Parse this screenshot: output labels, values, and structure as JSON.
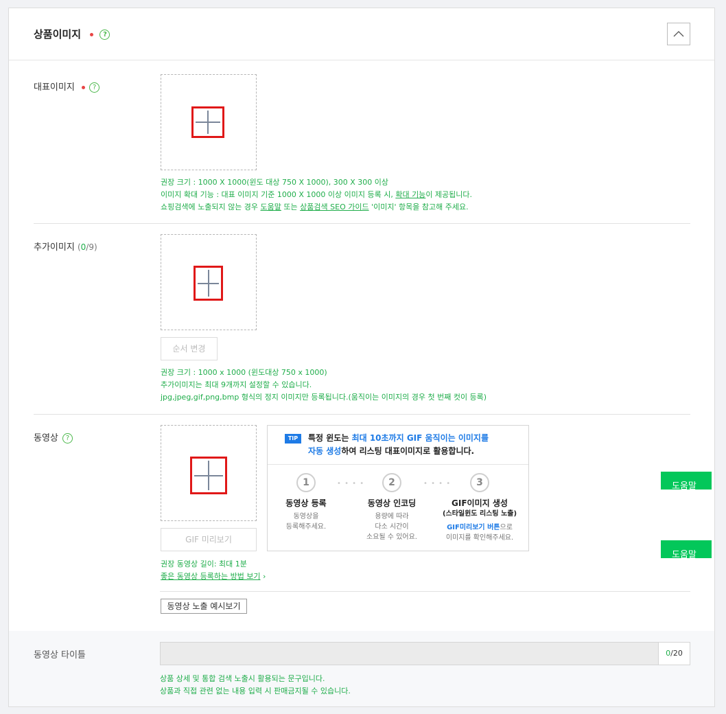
{
  "section": {
    "title": "상품이미지",
    "help": "?"
  },
  "main_image": {
    "label": "대표이미지",
    "help": "?",
    "hints": [
      "권장 크기 : 1000 X 1000(윈도 대상 750 X 1000), 300 X 300 이상",
      [
        "이미지 확대 기능 : 대표 이미지 기준 1000 X 1000 이상 이미지 등록 시, ",
        "확대 기능",
        "이 제공됩니다."
      ],
      [
        "쇼핑검색에 노출되지 않는 경우 ",
        "도움말",
        " 또는 ",
        "상품검색 SEO 가이드",
        " '이미지' 항목을 참고해 주세요."
      ]
    ]
  },
  "extra_image": {
    "label": "추가이미지",
    "count_open": "(",
    "count_current": "0",
    "count_total": "/9)",
    "reorder_button": "순서 변경",
    "hints": [
      "권장 크기 : 1000 x 1000 (윈도대상 750 x 1000)",
      "추가이미지는 최대 9개까지 설정할 수 있습니다.",
      "jpg,jpeg,gif,png,bmp 형식의 정지 이미지만 등록됩니다.(움직이는 이미지의 경우 첫 번째 컷이 등록)"
    ]
  },
  "video": {
    "label": "동영상",
    "help": "?",
    "gif_preview_button": "GIF 미리보기",
    "hint_length": "권장 동영상 길이: 최대 1분",
    "hint_link": "좋은 동영상 등록하는 방법 보기",
    "hint_link_arrow": "›",
    "preview_button": "동영상 노출 예시보기",
    "tip": {
      "badge": "TIP",
      "line1_a": "특정 윈도는 ",
      "line1_b": "최대 10초까지 GIF 움직이는 이미지를",
      "line2_a": "자동 생성",
      "line2_b": "하여 리스팅 대표이미지로 활용합니다.",
      "steps": [
        {
          "num": "1",
          "title": "동영상 등록",
          "desc1": "동영상을",
          "desc2": "등록해주세요."
        },
        {
          "num": "2",
          "title": "동영상 인코딩",
          "desc1": "용량에 따라",
          "desc2": "다소 시간이",
          "desc3": "소요될 수 있어요."
        },
        {
          "num": "3",
          "title": "GIF이미지 생성",
          "subtitle": "(스타일윈도 리스팅 노출)",
          "desc_strong": "GIF미리보기 버튼",
          "desc1_rest": "으로",
          "desc2": "이미지를 확인해주세요."
        }
      ],
      "dots": "• • • •"
    }
  },
  "help_tabs": [
    "도움말",
    "도움말"
  ],
  "video_title": {
    "label": "동영상 타이틀",
    "count_current": "0",
    "count_max": "/20",
    "hints": [
      "상품 상세 및 통합 검색 노출시 활용되는 문구입니다.",
      "상품과 직접 관련 없는 내용 입력 시 판매금지될 수 있습니다."
    ]
  }
}
